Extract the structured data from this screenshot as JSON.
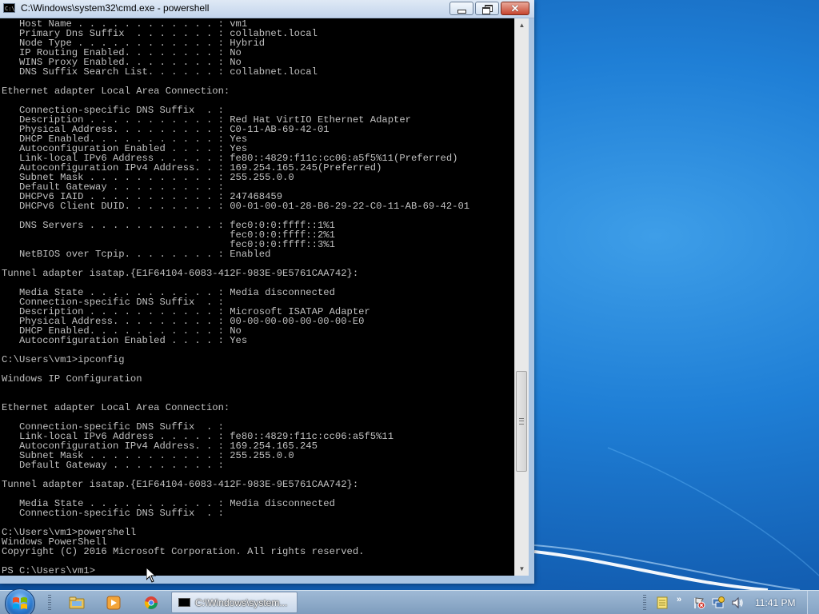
{
  "window": {
    "title": "C:\\Windows\\system32\\cmd.exe - powershell",
    "close_glyph": "✕"
  },
  "console": {
    "lines": [
      "   Host Name . . . . . . . . . . . . : vm1",
      "   Primary Dns Suffix  . . . . . . . : collabnet.local",
      "   Node Type . . . . . . . . . . . . : Hybrid",
      "   IP Routing Enabled. . . . . . . . : No",
      "   WINS Proxy Enabled. . . . . . . . : No",
      "   DNS Suffix Search List. . . . . . : collabnet.local",
      "",
      "Ethernet adapter Local Area Connection:",
      "",
      "   Connection-specific DNS Suffix  . :",
      "   Description . . . . . . . . . . . : Red Hat VirtIO Ethernet Adapter",
      "   Physical Address. . . . . . . . . : C0-11-AB-69-42-01",
      "   DHCP Enabled. . . . . . . . . . . : Yes",
      "   Autoconfiguration Enabled . . . . : Yes",
      "   Link-local IPv6 Address . . . . . : fe80::4829:f11c:cc06:a5f5%11(Preferred)",
      "   Autoconfiguration IPv4 Address. . : 169.254.165.245(Preferred)",
      "   Subnet Mask . . . . . . . . . . . : 255.255.0.0",
      "   Default Gateway . . . . . . . . . :",
      "   DHCPv6 IAID . . . . . . . . . . . : 247468459",
      "   DHCPv6 Client DUID. . . . . . . . : 00-01-00-01-28-B6-29-22-C0-11-AB-69-42-01",
      "",
      "   DNS Servers . . . . . . . . . . . : fec0:0:0:ffff::1%1",
      "                                       fec0:0:0:ffff::2%1",
      "                                       fec0:0:0:ffff::3%1",
      "   NetBIOS over Tcpip. . . . . . . . : Enabled",
      "",
      "Tunnel adapter isatap.{E1F64104-6083-412F-983E-9E5761CAA742}:",
      "",
      "   Media State . . . . . . . . . . . : Media disconnected",
      "   Connection-specific DNS Suffix  . :",
      "   Description . . . . . . . . . . . : Microsoft ISATAP Adapter",
      "   Physical Address. . . . . . . . . : 00-00-00-00-00-00-00-E0",
      "   DHCP Enabled. . . . . . . . . . . : No",
      "   Autoconfiguration Enabled . . . . : Yes",
      "",
      "C:\\Users\\vm1>ipconfig",
      "",
      "Windows IP Configuration",
      "",
      "",
      "Ethernet adapter Local Area Connection:",
      "",
      "   Connection-specific DNS Suffix  . :",
      "   Link-local IPv6 Address . . . . . : fe80::4829:f11c:cc06:a5f5%11",
      "   Autoconfiguration IPv4 Address. . : 169.254.165.245",
      "   Subnet Mask . . . . . . . . . . . : 255.255.0.0",
      "   Default Gateway . . . . . . . . . :",
      "",
      "Tunnel adapter isatap.{E1F64104-6083-412F-983E-9E5761CAA742}:",
      "",
      "   Media State . . . . . . . . . . . : Media disconnected",
      "   Connection-specific DNS Suffix  . :",
      "",
      "C:\\Users\\vm1>powershell",
      "Windows PowerShell",
      "Copyright (C) 2016 Microsoft Corporation. All rights reserved.",
      "",
      "PS C:\\Users\\vm1>"
    ]
  },
  "taskbar": {
    "task_label": "C:\\Windows\\system...",
    "chevron": "»",
    "clock": "11:41 PM"
  },
  "colors": {
    "console_bg": "#000000",
    "console_text": "#c0c0c0",
    "desktop_accent": "#1f7fd6",
    "close_button": "#c7452f"
  }
}
